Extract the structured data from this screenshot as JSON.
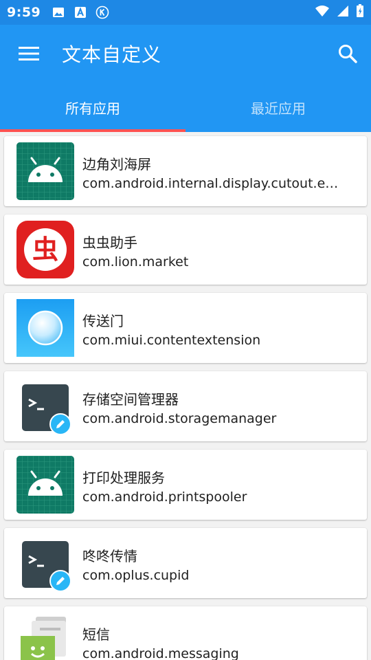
{
  "status_bar": {
    "time": "9:59",
    "left_icons": [
      "image-icon",
      "accessibility-a-icon",
      "k-circle-icon"
    ],
    "right_icons": [
      "wifi-icon",
      "signal-icon",
      "battery-icon"
    ]
  },
  "app_bar": {
    "title": "文本自定义",
    "menu_icon": "menu-icon",
    "search_icon": "search-icon",
    "color": "#2196f3"
  },
  "tabs": [
    {
      "label": "所有应用",
      "selected": true
    },
    {
      "label": "最近应用",
      "selected": false
    }
  ],
  "indicator_color": "#ff5252",
  "apps": [
    {
      "name": "边角刘海屏",
      "package": "com.android.internal.display.cutout.em…",
      "icon": "android-robot-icon"
    },
    {
      "name": "虫虫助手",
      "package": "com.lion.market",
      "icon": "chongchong-icon"
    },
    {
      "name": "传送门",
      "package": "com.miui.contentextension",
      "icon": "bubble-icon"
    },
    {
      "name": "存储空间管理器",
      "package": "com.android.storagemanager",
      "icon": "terminal-edit-icon"
    },
    {
      "name": "打印处理服务",
      "package": "com.android.printspooler",
      "icon": "android-robot-icon"
    },
    {
      "name": "咚咚传情",
      "package": "com.oplus.cupid",
      "icon": "terminal-edit-icon"
    },
    {
      "name": "短信",
      "package": "com.android.messaging",
      "icon": "messaging-icon"
    }
  ],
  "chongchong_glyph": "虫"
}
